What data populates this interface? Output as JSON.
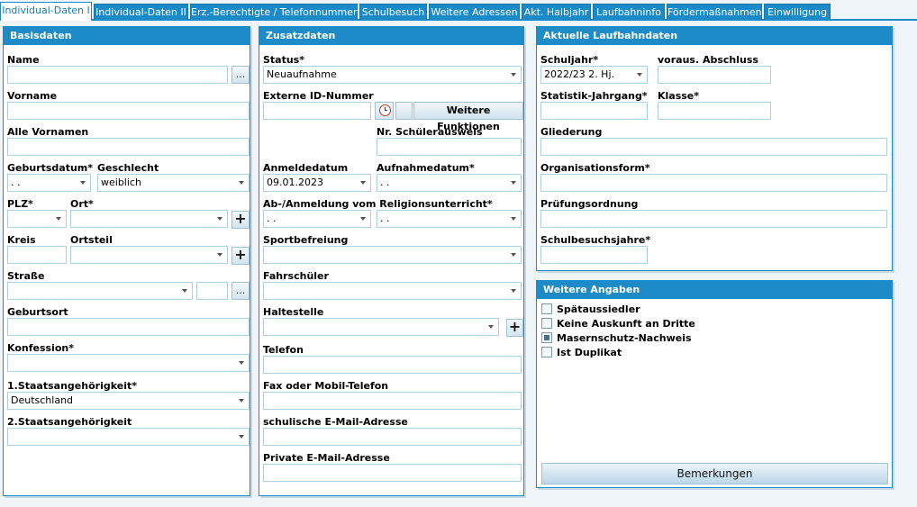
{
  "tabs": [
    {
      "label": "Individual-Daten I",
      "active": true
    },
    {
      "label": "Individual-Daten II"
    },
    {
      "label": "Erz.-Berechtigte / Telefonnummern"
    },
    {
      "label": "Schulbesuch"
    },
    {
      "label": "Weitere Adressen"
    },
    {
      "label": "Akt. Halbjahr"
    },
    {
      "label": "Laufbahninfo"
    },
    {
      "label": "Fördermaßnahmen"
    },
    {
      "label": "Einwilligung"
    }
  ],
  "basisdaten": {
    "title": "Basisdaten",
    "name_label": "Name",
    "name_value": "",
    "name_btn": "...",
    "vorname_label": "Vorname",
    "vorname_value": "",
    "allevornamen_label": "Alle Vornamen",
    "allevornamen_value": "",
    "geburtsdatum_label": "Geburtsdatum*",
    "geburtsdatum_value": ". .",
    "geschlecht_label": "Geschlecht",
    "geschlecht_value": "weiblich",
    "plz_label": "PLZ*",
    "plz_value": "",
    "ort_label": "Ort*",
    "ort_value": "",
    "ort_add": "+",
    "kreis_label": "Kreis",
    "kreis_value": "",
    "ortsteil_label": "Ortsteil",
    "ortsteil_value": "",
    "ortsteil_add": "+",
    "strasse_label": "Straße",
    "strasse_value": "",
    "hausnr_value": "",
    "strasse_btn": "...",
    "geburtsort_label": "Geburtsort",
    "geburtsort_value": "",
    "konfession_label": "Konfession*",
    "konfession_value": "",
    "staat1_label": "1.Staatsangehörigkeit*",
    "staat1_value": "Deutschland",
    "staat2_label": "2.Staatsangehörigkeit",
    "staat2_value": ""
  },
  "zusatzdaten": {
    "title": "Zusatzdaten",
    "status_label": "Status*",
    "status_value": "Neuaufnahme",
    "externeid_label": "Externe ID-Nummer",
    "externeid_value": "",
    "weitere_btn": "Weitere Funktionen",
    "schuelerausweis_label": "Nr. Schülerausweis",
    "schuelerausweis_value": "",
    "anmeldedatum_label": "Anmeldedatum",
    "anmeldedatum_value": "09.01.2023",
    "aufnahmedatum_label": "Aufnahmedatum*",
    "aufnahmedatum_value": ". .",
    "religion_label": "Ab-/Anmeldung vom Religionsunterricht*",
    "religion_ab_value": ". .",
    "religion_an_value": ". .",
    "sport_label": "Sportbefreiung",
    "sport_value": "",
    "fahr_label": "Fahrschüler",
    "fahr_value": "",
    "halt_label": "Haltestelle",
    "halt_value": "",
    "halt_add": "+",
    "telefon_label": "Telefon",
    "telefon_value": "",
    "fax_label": "Fax oder Mobil-Telefon",
    "fax_value": "",
    "schulmail_label": "schulische E-Mail-Adresse",
    "schulmail_value": "",
    "privmail_label": "Private E-Mail-Adresse",
    "privmail_value": ""
  },
  "laufbahn": {
    "title": "Aktuelle Laufbahndaten",
    "schuljahr_label": "Schuljahr*",
    "schuljahr_value": "2022/23 2. Hj.",
    "abschluss_label": "voraus. Abschluss",
    "abschluss_value": "",
    "jahrgang_label": "Statistik-Jahrgang*",
    "jahrgang_value": "",
    "klasse_label": "Klasse*",
    "klasse_value": "",
    "gliederung_label": "Gliederung",
    "gliederung_value": "",
    "orgform_label": "Organisationsform*",
    "orgform_value": "",
    "pruef_label": "Prüfungsordnung",
    "pruef_value": "",
    "schulbesuch_label": "Schulbesuchsjahre*",
    "schulbesuch_value": ""
  },
  "weitere": {
    "title": "Weitere Angaben",
    "checkboxes": [
      {
        "label": "Spätaussiedler",
        "checked": false
      },
      {
        "label": "Keine Auskunft an Dritte",
        "checked": false
      },
      {
        "label": "Masernschutz-Nachweis",
        "checked": true
      },
      {
        "label": "Ist Duplikat",
        "checked": false
      }
    ],
    "bemerkungen_btn": "Bemerkungen"
  }
}
